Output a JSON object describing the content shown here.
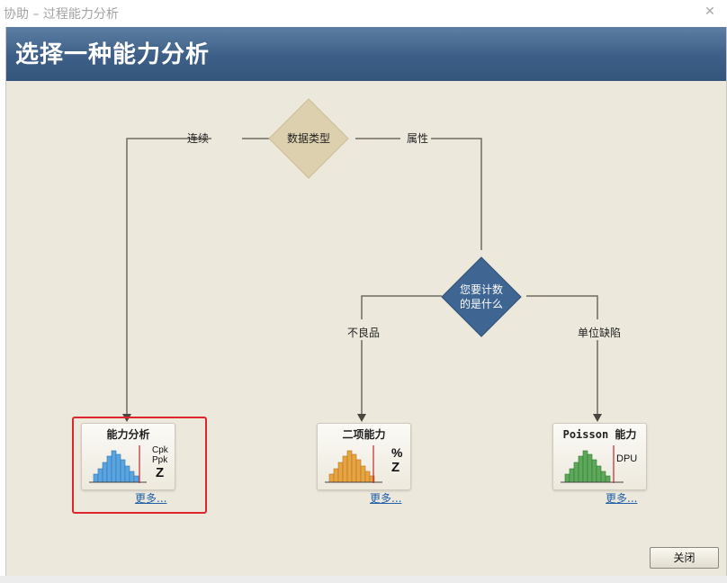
{
  "window": {
    "title": "协助 – 过程能力分析",
    "close_glyph": "✕"
  },
  "header": {
    "title": "选择一种能力分析"
  },
  "flow": {
    "data_type_label": "数据类型",
    "branch_continuous": "连续",
    "branch_attribute": "属性",
    "count_question_line1": "您要计数",
    "count_question_line2": "的是什么",
    "branch_defectives": "不良品",
    "branch_defects_per_unit": "单位缺陷"
  },
  "cards": {
    "capability": {
      "title": "能力分析",
      "stat_lines": [
        "Cpk",
        "Ppk",
        "Z"
      ],
      "more": "更多...",
      "color": "#5aa5e0",
      "selected": true
    },
    "binomial": {
      "title": "二项能力",
      "stat_lines": [
        "%",
        "Z"
      ],
      "more": "更多...",
      "color": "#e7a443"
    },
    "poisson": {
      "title": "Poisson 能力",
      "stat_lines": [
        "DPU"
      ],
      "more": "更多...",
      "color": "#5da85a"
    }
  },
  "footer": {
    "close_label": "关闭"
  },
  "colors": {
    "header_bg": "#3d5f87",
    "diamond_tan": "#ddd0ae",
    "diamond_blue": "#3f6592",
    "selection_border": "#e0262d",
    "link": "#1e5fa8"
  }
}
